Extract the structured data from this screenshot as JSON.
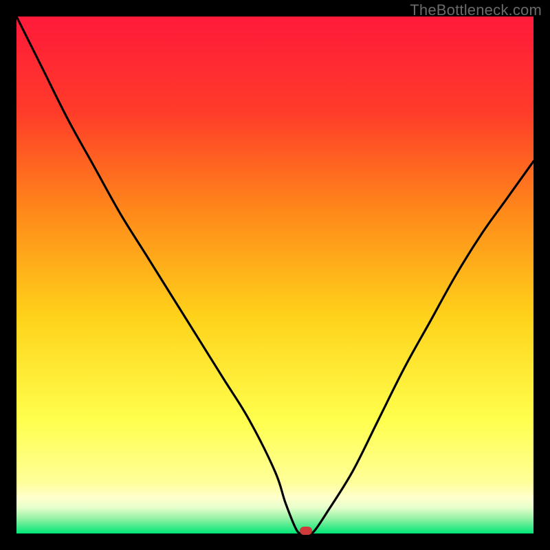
{
  "watermark": "TheBottleneck.com",
  "colors": {
    "frame": "#000000",
    "curve": "#000000",
    "marker": "#cf3b3b",
    "gradient_top": "#ff1a3a",
    "gradient_mid1": "#ff7a1a",
    "gradient_mid2": "#ffd21a",
    "gradient_mid3": "#ffff66",
    "gradient_pale": "#ffffcc",
    "gradient_bottom": "#00e676"
  },
  "chart_data": {
    "type": "line",
    "title": "",
    "xlabel": "",
    "ylabel": "",
    "ylim": [
      0,
      100
    ],
    "x": [
      0,
      5,
      10,
      15,
      20,
      25,
      30,
      35,
      40,
      45,
      50,
      52,
      54,
      55,
      56,
      57,
      58,
      60,
      65,
      70,
      75,
      80,
      85,
      90,
      95,
      100
    ],
    "series": [
      {
        "name": "bottleneck-curve",
        "values": [
          100,
          90,
          80,
          71,
          62,
          54,
          46,
          38,
          30,
          22,
          12,
          6,
          1,
          0,
          0,
          0,
          1,
          4,
          12,
          22,
          32,
          41,
          50,
          58,
          65,
          72
        ]
      }
    ],
    "marker": {
      "x": 56,
      "y": 0
    },
    "annotations": []
  }
}
